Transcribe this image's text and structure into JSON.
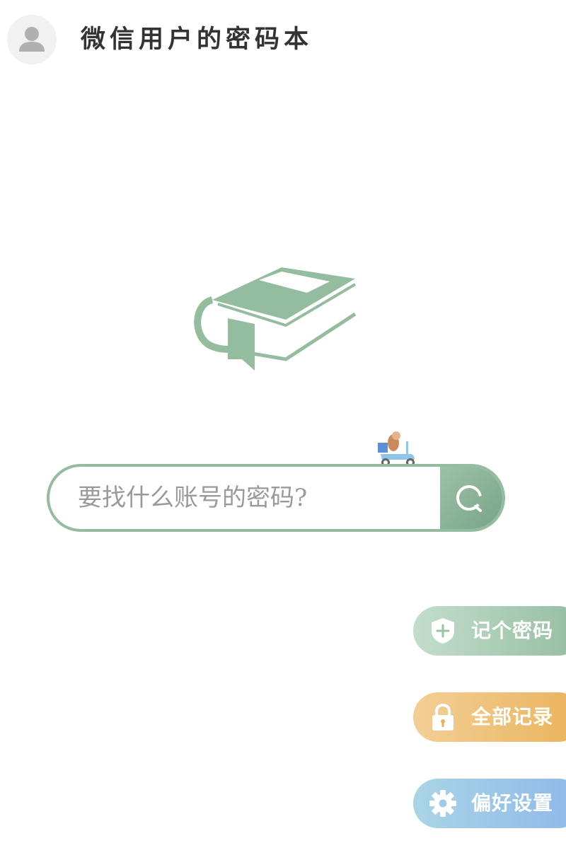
{
  "header": {
    "avatar_icon": "default-user-avatar-icon",
    "title": "微信用户的密码本"
  },
  "hero": {
    "icon": "book-with-bookmark-icon",
    "icon_color": "#94bda0"
  },
  "decoration": {
    "icon": "hedgehog-on-scooter-icon"
  },
  "search": {
    "placeholder": "要找什么账号的密码?",
    "value": "",
    "button_icon": "search-icon",
    "border_color": "#94bda0"
  },
  "actions": [
    {
      "label": "记个密码",
      "icon": "shield-plus-icon",
      "color": "#94bda0"
    },
    {
      "label": "全部记录",
      "icon": "lock-icon",
      "color": "#e9b35c"
    },
    {
      "label": "偏好设置",
      "icon": "gear-icon",
      "color": "#8fb7eb"
    }
  ]
}
